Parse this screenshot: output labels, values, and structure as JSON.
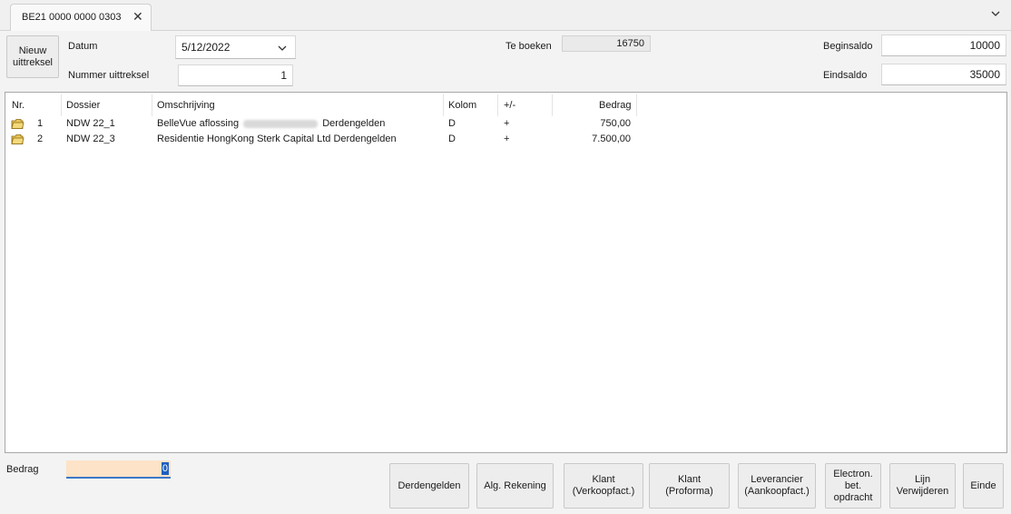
{
  "tab": {
    "title": "BE21 0000 0000 0303",
    "close": "✕"
  },
  "header": {
    "new_statement_label": "Nieuw uittreksel",
    "date_label": "Datum",
    "date_value": "5/12/2022",
    "statement_number_label": "Nummer uittreksel",
    "statement_number_value": "1",
    "to_book_label": "Te boeken",
    "to_book_value": "16750",
    "begin_balance_label": "Beginsaldo",
    "begin_balance_value": "10000",
    "end_balance_label": "Eindsaldo",
    "end_balance_value": "35000"
  },
  "table": {
    "columns": [
      "Nr.",
      "Dossier",
      "Omschrijving",
      "Kolom",
      "+/-",
      "Bedrag"
    ],
    "rows": [
      {
        "nr": "1",
        "dossier": "NDW 22_1",
        "desc_pre": "BelleVue aflossing",
        "desc_post": "Derdengelden",
        "kolom": "D",
        "sign": "+",
        "bedrag": "750,00"
      },
      {
        "nr": "2",
        "dossier": "NDW 22_3",
        "desc_pre": "Residentie HongKong Sterk Capital Ltd Derdengelden",
        "desc_post": "",
        "kolom": "D",
        "sign": "+",
        "bedrag": "7.500,00"
      }
    ]
  },
  "footer": {
    "amount_label": "Bedrag",
    "amount_value": "0",
    "buttons": {
      "derdengelden": "Derdengelden",
      "alg_rekening": "Alg. Rekening",
      "klant_verkoop_1": "Klant",
      "klant_verkoop_2": "(Verkoopfact.)",
      "klant_proforma_1": "Klant",
      "klant_proforma_2": "(Proforma)",
      "leverancier_1": "Leverancier",
      "leverancier_2": "(Aankoopfact.)",
      "electron_1": "Electron.",
      "electron_2": "bet.",
      "electron_3": "opdracht",
      "lijn_1": "Lijn",
      "lijn_2": "Verwijderen",
      "einde": "Einde"
    }
  },
  "colors": {
    "accent": "#3c78c8",
    "amount_bg": "#fde3c7",
    "folder": "#e8c45a"
  }
}
